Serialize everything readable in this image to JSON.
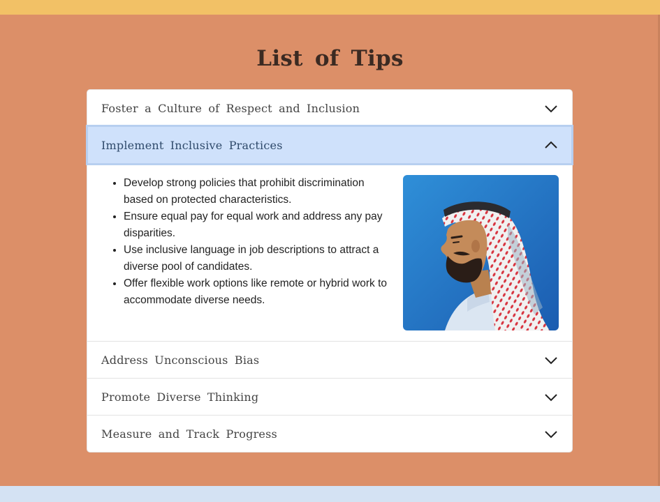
{
  "page": {
    "title": "List of Tips"
  },
  "accordion": {
    "items": [
      {
        "label": "Foster a Culture of Respect and Inclusion",
        "expanded": false
      },
      {
        "label": "Implement Inclusive Practices",
        "expanded": true,
        "bullets": [
          "Develop strong policies that prohibit discrimination based on protected characteristics.",
          "Ensure equal pay for equal work and address any pay disparities.",
          "Use inclusive language in job descriptions to attract a diverse pool of candidates.",
          "Offer flexible work options like remote or hybrid work to accommodate diverse needs."
        ]
      },
      {
        "label": "Address Unconscious Bias",
        "expanded": false
      },
      {
        "label": "Promote Diverse Thinking",
        "expanded": false
      },
      {
        "label": "Measure and Track Progress",
        "expanded": false
      }
    ]
  },
  "icons": {
    "collapsed": "chevron-down-icon",
    "expanded": "chevron-up-icon"
  },
  "colors": {
    "page_background": "#dc8f68",
    "top_bar": "#f2c166",
    "bottom_bar": "#d4e2f3",
    "active_header": "#cfe1fb"
  }
}
